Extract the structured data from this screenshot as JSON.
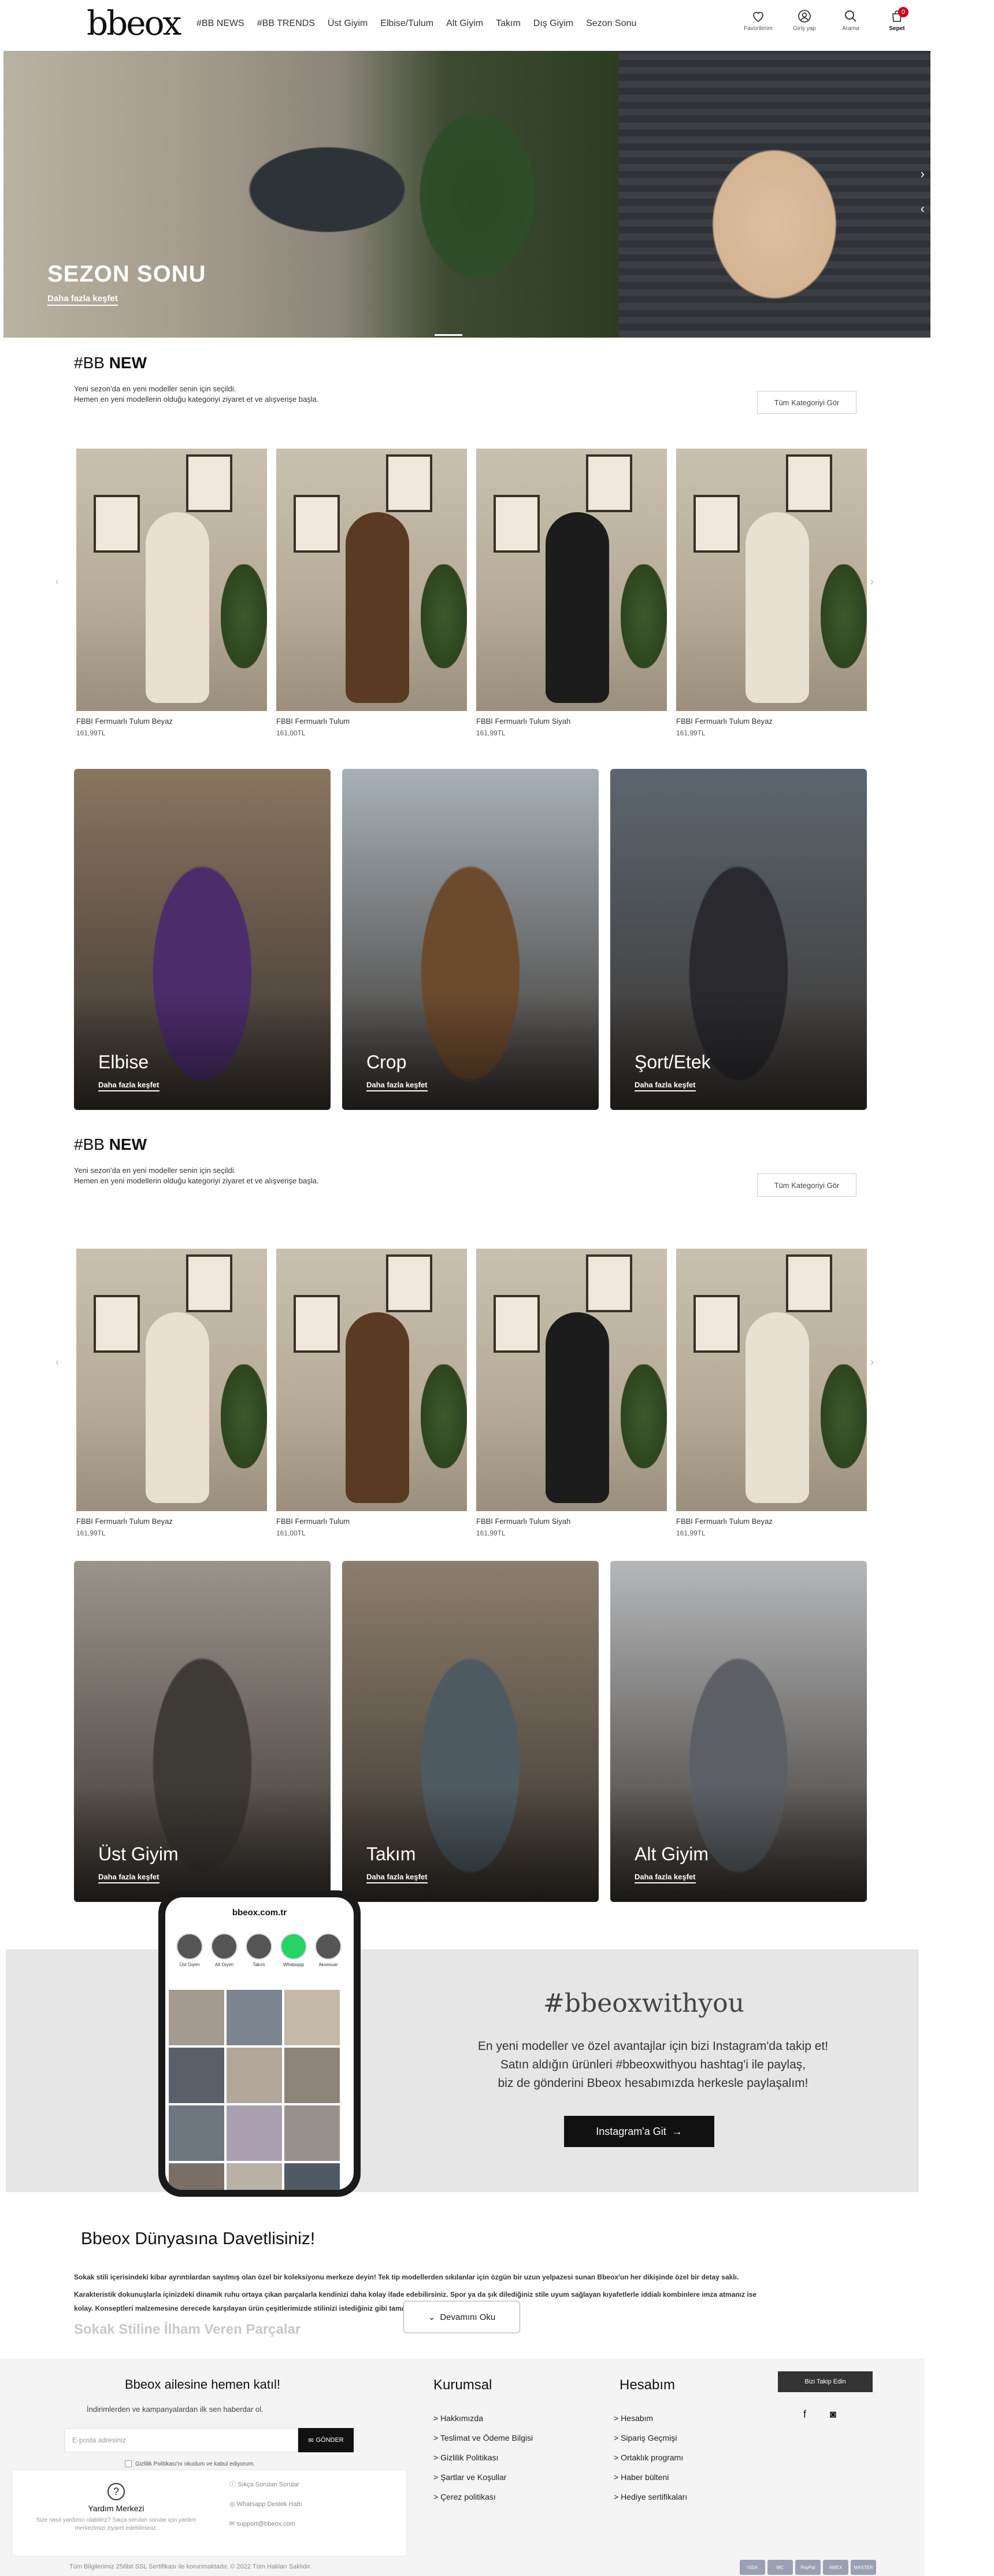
{
  "header": {
    "logo": "bbeox",
    "nav": [
      "#BB NEWS",
      "#BB TRENDS",
      "Üst Giyim",
      "Elbise/Tulum",
      "Alt Giyim",
      "Takım",
      "Dış Giyim",
      "Sezon Sonu"
    ],
    "icons": [
      {
        "icon": "heart-icon",
        "label": "Favorilerim"
      },
      {
        "icon": "user-icon",
        "label": "Giriş yap"
      },
      {
        "icon": "search-icon",
        "label": "Arama"
      },
      {
        "icon": "bag-icon",
        "label": "Sepet"
      }
    ],
    "cart_count": "0"
  },
  "hero": {
    "title": "SEZON SONU",
    "link": "Daha fazla keşfet"
  },
  "new_section_1": {
    "title_prefix": "#BB ",
    "title_bold": "NEW",
    "desc1": "Yeni sezon'da en yeni modeller senin için seçildi.",
    "desc2": "Hemen en yeni modellerin olduğu kategoriyi ziyaret et ve alışverişe başla.",
    "button": "Tüm Kategoriyi Gör"
  },
  "products_1": [
    {
      "name": "FBBI Fermuarlı Tulum Beyaz",
      "price": "161,99TL",
      "color": "#e8e0d0"
    },
    {
      "name": "FBBI Fermuarlı Tulum",
      "price": "161,00TL",
      "color": "#5a3a22"
    },
    {
      "name": "FBBI Fermuarlı Tulum Siyah",
      "price": "161,99TL",
      "color": "#1c1c1c"
    },
    {
      "name": "FBBI Fermuarlı Tulum Beyaz",
      "price": "161,99TL",
      "color": "#e8e0d0"
    }
  ],
  "categories_1": [
    {
      "title": "Elbise",
      "link": "Daha fazla keşfet",
      "bg": "#4b2d6b",
      "bg2": "#8a7560"
    },
    {
      "title": "Crop",
      "link": "Daha fazla keşfet",
      "bg": "#6b4a2e",
      "bg2": "#a7b0b8"
    },
    {
      "title": "Şort/Etek",
      "link": "Daha fazla keşfet",
      "bg": "#2a2a2e",
      "bg2": "#5c6670"
    }
  ],
  "new_section_2": {
    "title_prefix": "#BB ",
    "title_bold": "NEW",
    "desc1": "Yeni sezon'da en yeni modeller senin için seçildi.",
    "desc2": "Hemen en yeni modellerin olduğu kategoriyi ziyaret et ve alışverişe başla.",
    "button": "Tüm Kategoriyi Gör"
  },
  "products_2": [
    {
      "name": "FBBI Fermuarlı Tulum Beyaz",
      "price": "161,99TL",
      "color": "#e8e0d0"
    },
    {
      "name": "FBBI Fermuarlı Tulum",
      "price": "161,00TL",
      "color": "#5a3a22"
    },
    {
      "name": "FBBI Fermuarlı Tulum Siyah",
      "price": "161,99TL",
      "color": "#1c1c1c"
    },
    {
      "name": "FBBI Fermuarlı Tulum Beyaz",
      "price": "161,99TL",
      "color": "#e8e0d0"
    }
  ],
  "categories_2": [
    {
      "title": "Üst Giyim",
      "link": "Daha fazla keşfet",
      "bg": "#3e3a36",
      "bg2": "#9b948c"
    },
    {
      "title": "Takım",
      "link": "Daha fazla keşfet",
      "bg": "#4e5a62",
      "bg2": "#8c7e6c"
    },
    {
      "title": "Alt Giyim",
      "link": "Daha fazla keşfet",
      "bg": "#5c6064",
      "bg2": "#b5b7b9"
    }
  ],
  "instagram": {
    "phone_url": "bbeox.com.tr",
    "stories": [
      "Üst Giyim",
      "Alt Giyim",
      "Takım",
      "Whatsapp",
      "Aksesuar"
    ],
    "title": "#bbeoxwithyou",
    "text1": "En yeni modeller ve özel avantajlar için bizi Instagram'da takip et!",
    "text2": "Satın aldığın ürünleri #bbeoxwithyou hashtag'i ile paylaş,",
    "text3": "biz de gönderini Bbeox hesabımızda herkesle paylaşalım!",
    "button": "Instagram'a Git"
  },
  "about": {
    "title": "Bbeox Dünyasına Davetlisiniz!",
    "p1": "Sokak stili içerisindeki kibar ayrıntılardan sayılmış olan özel bir koleksiyonu merkeze deyin! Tek tip modellerden sıkılanlar için özgün bir uzun yelpazesi sunan Bbeox'un her dikişinde özel bir detay saklı.",
    "p2": "Karakteristik dokunuşlarla içinizdeki dinamik ruhu ortaya çıkan parçalarla kendinizi daha kolay ifade edebilirsiniz. Spor ya da şık dilediğiniz stile uyum sağlayan kıyafetlerle iddialı kombinlere imza atmanız ise",
    "p3": "kolay. Konseptleri malzemesine derecede karşılayan ürün çeşitlerimizde stilinizi istediğiniz gibi tamamlamak oldukça kolay.",
    "fade": "Sokak Stiline İlham Veren Parçalar",
    "read_more": "Devamını Oku"
  },
  "footer": {
    "nl_title": "Bbeox ailesine hemen katıl!",
    "nl_sub": "İndirimlerden ve kampanyalardan ilk sen haberdar ol.",
    "nl_placeholder": "E-posta adresiniz",
    "nl_button": "GÖNDER",
    "nl_check": "Gizlilik Politikası'nı okudum ve kabul ediyorum.",
    "help_title": "Yardım Merkezi",
    "help_desc": "Size nasıl yardımcı olabiliriz? Sıkça sorulan sorular için yardım merkezimizi ziyaret edebilirsiniz.",
    "help_items": [
      "Sıkça Sorulan Sorular",
      "Whatsapp Destek Hattı",
      "support@bbeox.com"
    ],
    "col1_title": "Kurumsal",
    "col1": [
      "> Hakkımızda",
      "> Teslimat ve Ödeme Bilgisi",
      "> Gizlilik Politikası",
      "> Şartlar ve Koşullar",
      "> Çerez politikası"
    ],
    "col2_title": "Hesabım",
    "col2": [
      "> Hesabım",
      "> Sipariş Geçmişi",
      "> Ortaklık programı",
      "> Haber bülteni",
      "> Hediye sertifikaları"
    ],
    "follow": "Bizi Takip Edin",
    "copyright": "Tüm Bilgilerimiz 256bit SSL Sertifikası ile korunmaktadır. © 2022 Tüm Hakları Saklıdır.",
    "payments": [
      "VISA",
      "MC",
      "PayPal",
      "AMEX",
      "MASTER"
    ]
  }
}
